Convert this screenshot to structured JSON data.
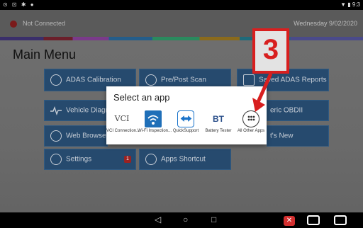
{
  "status_bar": {
    "left_icons": "⊙ ⊡ ✱ ●",
    "right_text": "▼ ▮ 9:3"
  },
  "header": {
    "connection_status": "Not Connected",
    "date": "Wednesday 9/02/2020"
  },
  "main": {
    "title": "Main Menu",
    "tiles": [
      {
        "label": "ADAS Calibration"
      },
      {
        "label": "Pre/Post Scan"
      },
      {
        "label": "Saved ADAS Reports"
      },
      {
        "label": "Vehicle Diagno"
      },
      {
        "label": "eric OBDII"
      },
      {
        "label": "Web Browser"
      },
      {
        "label": "t's New"
      },
      {
        "label": "Settings",
        "badge": "1"
      },
      {
        "label": "Apps Shortcut"
      }
    ]
  },
  "dialog": {
    "title": "Select an app",
    "apps": [
      {
        "name": "VCI Connection...",
        "icon_text": "VCI"
      },
      {
        "name": "Wi-Fi Inspection...",
        "icon": "wifi-icon"
      },
      {
        "name": "QuickSupport",
        "icon": "teamviewer-icon"
      },
      {
        "name": "Battery Tester",
        "icon_text": "BT"
      },
      {
        "name": "All Other Apps",
        "icon": "grid-icon"
      }
    ]
  },
  "annotation": {
    "number": "3",
    "color": "#d81f1f"
  },
  "navbar": {
    "back": "◁",
    "home": "○",
    "recent": "□"
  }
}
